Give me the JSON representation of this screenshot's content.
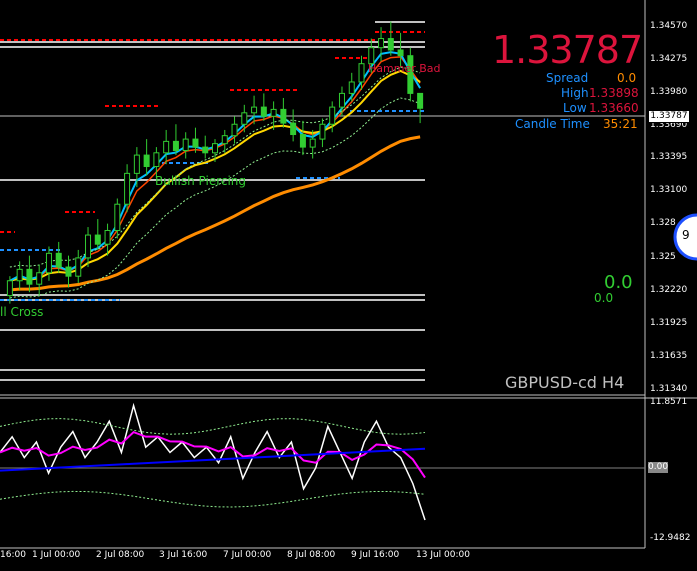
{
  "chart_data": {
    "type": "candlestick",
    "symbol": "GBPUSD-cd",
    "timeframe": "H4",
    "current_price": "1.33787",
    "info_panel": {
      "spread_label": "Spread",
      "spread_value": "0.0",
      "high_label": "High",
      "high_value": "1.33898",
      "low_label": "Low",
      "low_value": "1.33660",
      "candle_time_label": "Candle Time",
      "candle_time_value": "35:21"
    },
    "price_axis": [
      "1.34570",
      "1.34275",
      "1.33980",
      "1.33690",
      "1.33395",
      "1.33100",
      "1.328",
      "1.325",
      "1.32220",
      "1.31925",
      "1.31635",
      "1.31340"
    ],
    "price_marker": "1.33787",
    "osc_axis": [
      "11.8571",
      "0.00",
      "-12.9482"
    ],
    "time_axis": [
      "16:00",
      "1 Jul 00:00",
      "2 Jul 08:00",
      "3 Jul 16:00",
      "7 Jul 00:00",
      "8 Jul 08:00",
      "9 Jul 16:00",
      "13 Jul 00:00"
    ],
    "annotations": [
      "Bullish Piercing",
      "ll Cross",
      "Hammer Bad"
    ],
    "green_values": [
      "0.0",
      "0.0"
    ],
    "clock_digit": "9",
    "candles": [
      [
        1.3215,
        1.3232,
        1.3208,
        1.3228
      ],
      [
        1.3228,
        1.3245,
        1.322,
        1.3238
      ],
      [
        1.3238,
        1.325,
        1.3218,
        1.3225
      ],
      [
        1.3225,
        1.3242,
        1.3215,
        1.3235
      ],
      [
        1.3235,
        1.3258,
        1.3228,
        1.3252
      ],
      [
        1.3252,
        1.3262,
        1.3235,
        1.324
      ],
      [
        1.324,
        1.325,
        1.3222,
        1.3232
      ],
      [
        1.3232,
        1.3255,
        1.3226,
        1.3248
      ],
      [
        1.3248,
        1.3275,
        1.324,
        1.3268
      ],
      [
        1.3268,
        1.3282,
        1.3255,
        1.326
      ],
      [
        1.326,
        1.3278,
        1.325,
        1.3272
      ],
      [
        1.3272,
        1.33,
        1.3265,
        1.3295
      ],
      [
        1.3295,
        1.333,
        1.3288,
        1.3322
      ],
      [
        1.3322,
        1.3345,
        1.331,
        1.3338
      ],
      [
        1.3338,
        1.3352,
        1.332,
        1.3328
      ],
      [
        1.3328,
        1.3345,
        1.3318,
        1.334
      ],
      [
        1.334,
        1.336,
        1.333,
        1.335
      ],
      [
        1.335,
        1.3365,
        1.3338,
        1.3342
      ],
      [
        1.3342,
        1.3358,
        1.3335,
        1.3352
      ],
      [
        1.3352,
        1.3362,
        1.334,
        1.3345
      ],
      [
        1.3345,
        1.3355,
        1.3335,
        1.334
      ],
      [
        1.334,
        1.3352,
        1.3332,
        1.3348
      ],
      [
        1.3348,
        1.336,
        1.334,
        1.3355
      ],
      [
        1.3355,
        1.3372,
        1.3348,
        1.3365
      ],
      [
        1.3365,
        1.3382,
        1.3358,
        1.3375
      ],
      [
        1.3375,
        1.339,
        1.3365,
        1.338
      ],
      [
        1.338,
        1.3392,
        1.3368,
        1.3372
      ],
      [
        1.3372,
        1.3385,
        1.336,
        1.3378
      ],
      [
        1.3378,
        1.3388,
        1.3362,
        1.3366
      ],
      [
        1.3366,
        1.3378,
        1.335,
        1.3356
      ],
      [
        1.3356,
        1.3368,
        1.3338,
        1.3345
      ],
      [
        1.3345,
        1.336,
        1.3335,
        1.3352
      ],
      [
        1.3352,
        1.337,
        1.3345,
        1.3365
      ],
      [
        1.3365,
        1.3385,
        1.3358,
        1.338
      ],
      [
        1.338,
        1.3398,
        1.3372,
        1.3392
      ],
      [
        1.3392,
        1.341,
        1.3385,
        1.3402
      ],
      [
        1.3402,
        1.3425,
        1.3395,
        1.3418
      ],
      [
        1.3418,
        1.344,
        1.341,
        1.3432
      ],
      [
        1.3432,
        1.345,
        1.342,
        1.344
      ],
      [
        1.344,
        1.3455,
        1.3425,
        1.343
      ],
      [
        1.343,
        1.3445,
        1.3415,
        1.3425
      ],
      [
        1.3425,
        1.3432,
        1.3385,
        1.3392
      ],
      [
        1.3392,
        1.339,
        1.3366,
        1.3379
      ]
    ],
    "oscillator_white": [
      3,
      6,
      2,
      5,
      -1,
      4,
      7,
      2,
      5,
      9,
      3,
      12,
      4,
      6,
      3,
      5,
      2,
      4,
      1,
      6,
      -2,
      3,
      7,
      2,
      5,
      -4,
      0,
      8,
      3,
      -2,
      5,
      9,
      4,
      2,
      -3,
      -10
    ]
  },
  "colors": {
    "bg": "#000000",
    "grid": "#c0c0c0",
    "price": "#dc143c",
    "label": "#1e90ff",
    "value_orange": "#ff8c00",
    "green": "#32cd32",
    "ema_orange": "#ff8c00",
    "ema_yellow": "#ffd700",
    "ema_blue": "#00bfff",
    "magenta": "#ff00ff"
  }
}
